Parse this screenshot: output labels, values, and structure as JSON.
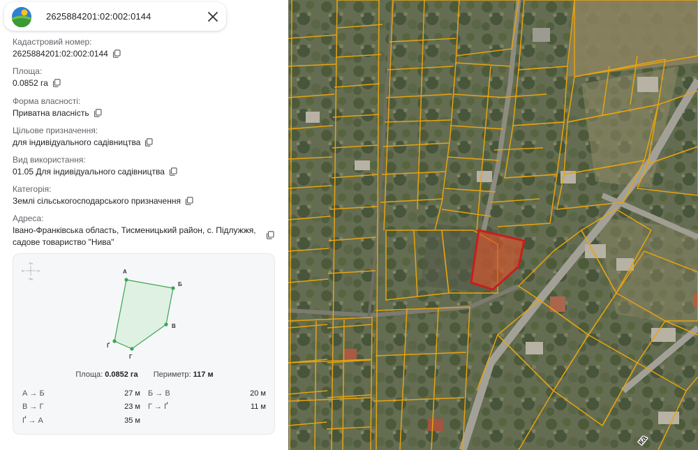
{
  "search": {
    "value": "2625884201:02:002:0144"
  },
  "fields": [
    {
      "label": "Кадастровий номер:",
      "value": "2625884201:02:002:0144"
    },
    {
      "label": "Площа:",
      "value": "0.0852 га"
    },
    {
      "label": "Форма власності:",
      "value": "Приватна власність"
    },
    {
      "label": "Цільове призначення:",
      "value": "для індивідуального садівництва"
    },
    {
      "label": "Вид використання:",
      "value": "01.05 Для індивідуального садівництва"
    },
    {
      "label": "Категорія:",
      "value": "Землі сільськогосподарського призначення"
    }
  ],
  "address": {
    "label": "Адреса:",
    "line1": "Івано-Франківська область, Тисменицький район, с. Підлужжя,",
    "line2": "садове товариство \"Нива\""
  },
  "plot": {
    "vertices": [
      "А",
      "Б",
      "В",
      "Г",
      "Ґ"
    ],
    "compass": {
      "north": "Пн",
      "south": "Пд",
      "west": "Зх",
      "east": "Сх"
    },
    "area_label": "Площа:",
    "area_value": "0.0852 га",
    "perimeter_label": "Периметр:",
    "perimeter_value": "117 м",
    "edges": [
      {
        "name": "А → Б",
        "length": "27 м"
      },
      {
        "name": "Б → В",
        "length": "20 м"
      },
      {
        "name": "В → Г",
        "length": "23 м"
      },
      {
        "name": "Г → Ґ",
        "length": "11 м"
      },
      {
        "name": "Ґ → А",
        "length": "35 м"
      }
    ]
  },
  "map": {
    "street_label_fragment": "ка"
  },
  "colors": {
    "parcel_outline": "#e8a30f",
    "selected_parcel": "#c81e1e",
    "plot_shape": "#3aa655"
  }
}
